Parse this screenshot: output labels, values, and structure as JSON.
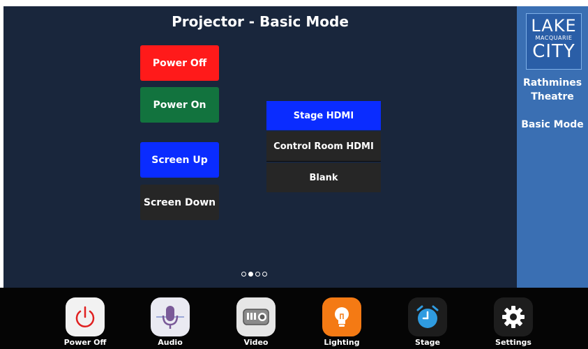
{
  "page": {
    "title": "Projector - Basic Mode"
  },
  "controls": {
    "power_off": "Power Off",
    "power_on": "Power On",
    "screen_up": "Screen Up",
    "screen_down": "Screen Down"
  },
  "sources": {
    "items": [
      {
        "label": "Stage HDMI",
        "selected": true
      },
      {
        "label": "Control Room HDMI",
        "selected": false
      },
      {
        "label": "Blank",
        "selected": false
      }
    ]
  },
  "pager": {
    "total": 4,
    "current": 2
  },
  "sidebar": {
    "logo_line1": "LAKE",
    "logo_line2": "MACQUARIE",
    "logo_line3": "CITY",
    "venue_line1": "Rathmines",
    "venue_line2": "Theatre",
    "mode": "Basic Mode"
  },
  "dock": {
    "items": [
      {
        "label": "Power Off",
        "icon": "power-icon"
      },
      {
        "label": "Audio",
        "icon": "microphone-icon"
      },
      {
        "label": "Video",
        "icon": "projector-icon"
      },
      {
        "label": "Lighting",
        "icon": "lightbulb-icon"
      },
      {
        "label": "Stage",
        "icon": "alarm-clock-icon"
      },
      {
        "label": "Settings",
        "icon": "gear-icon"
      }
    ]
  },
  "colors": {
    "background": "#19263c",
    "power_off": "#ff1a1a",
    "power_on": "#12733e",
    "blue": "#0a2cff",
    "dark_button": "#262626",
    "sidebar": "#3a6fb3"
  }
}
